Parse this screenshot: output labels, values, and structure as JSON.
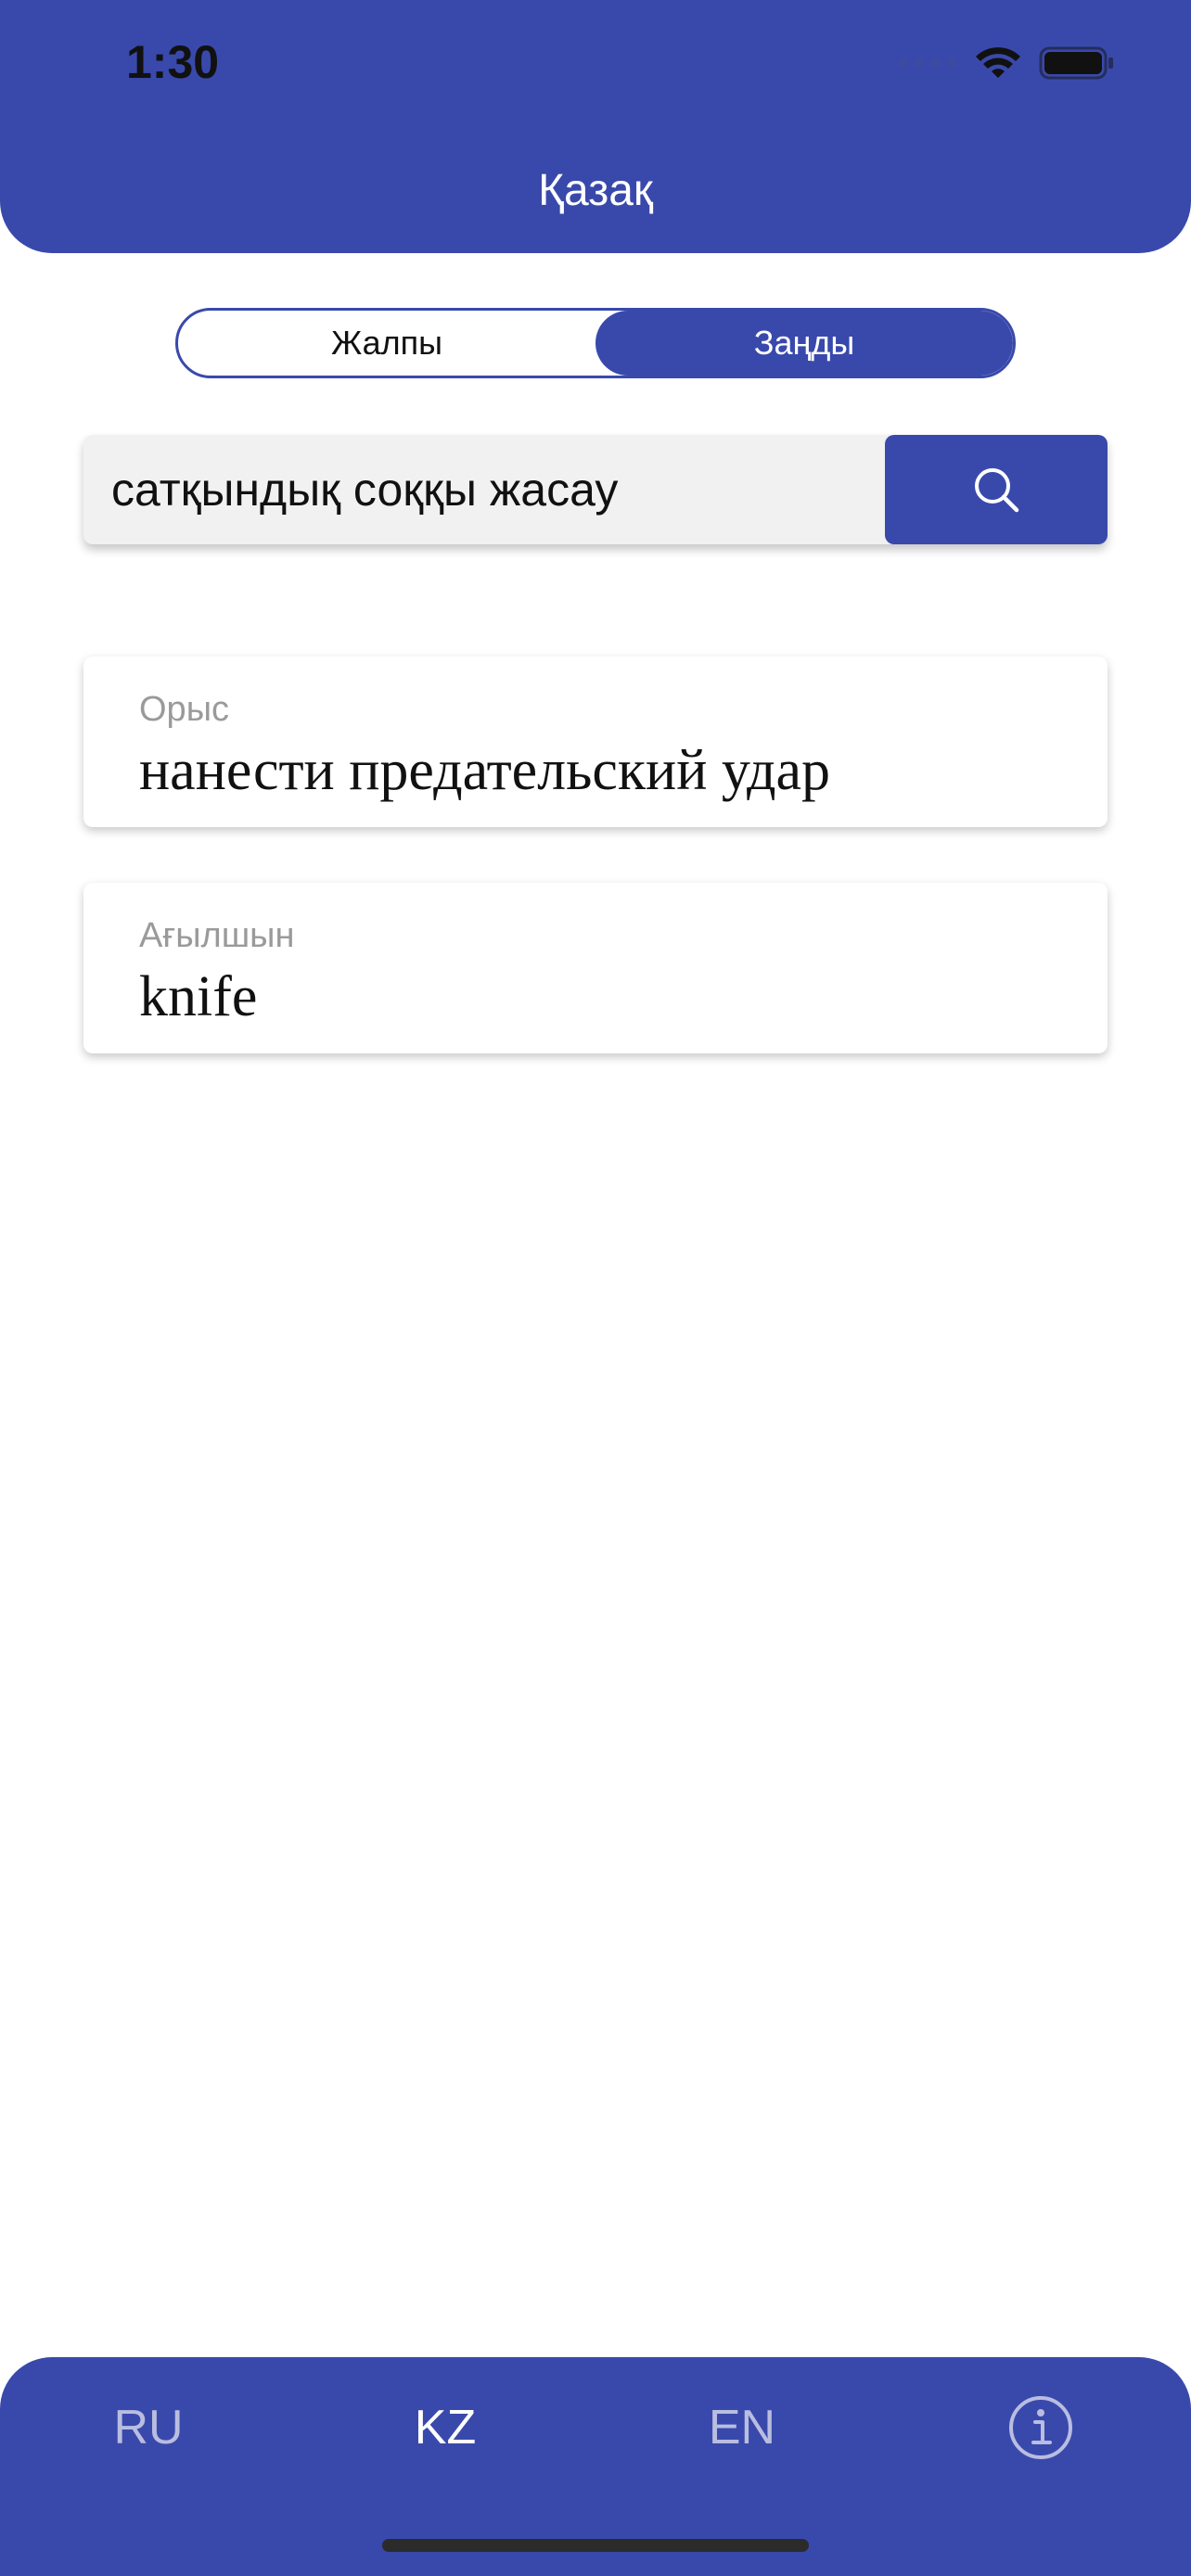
{
  "status_bar": {
    "time": "1:30"
  },
  "header": {
    "title": "Қазақ"
  },
  "segment": {
    "options": [
      "Жалпы",
      "Заңды"
    ],
    "selected": "Заңды"
  },
  "search": {
    "value": "сатқындық соққы жасау",
    "button_icon": "search-icon"
  },
  "results": [
    {
      "label": "Орыс",
      "value": "нанести предательский удар"
    },
    {
      "label": "Ағылшын",
      "value": "knife"
    }
  ],
  "tabbar": {
    "tabs": [
      "RU",
      "KZ",
      "EN"
    ],
    "active": "KZ",
    "info_icon": "info-icon"
  },
  "colors": {
    "primary": "#3949ab",
    "search_bg": "#f1f1f1",
    "label_gray": "#9a9a9a"
  }
}
